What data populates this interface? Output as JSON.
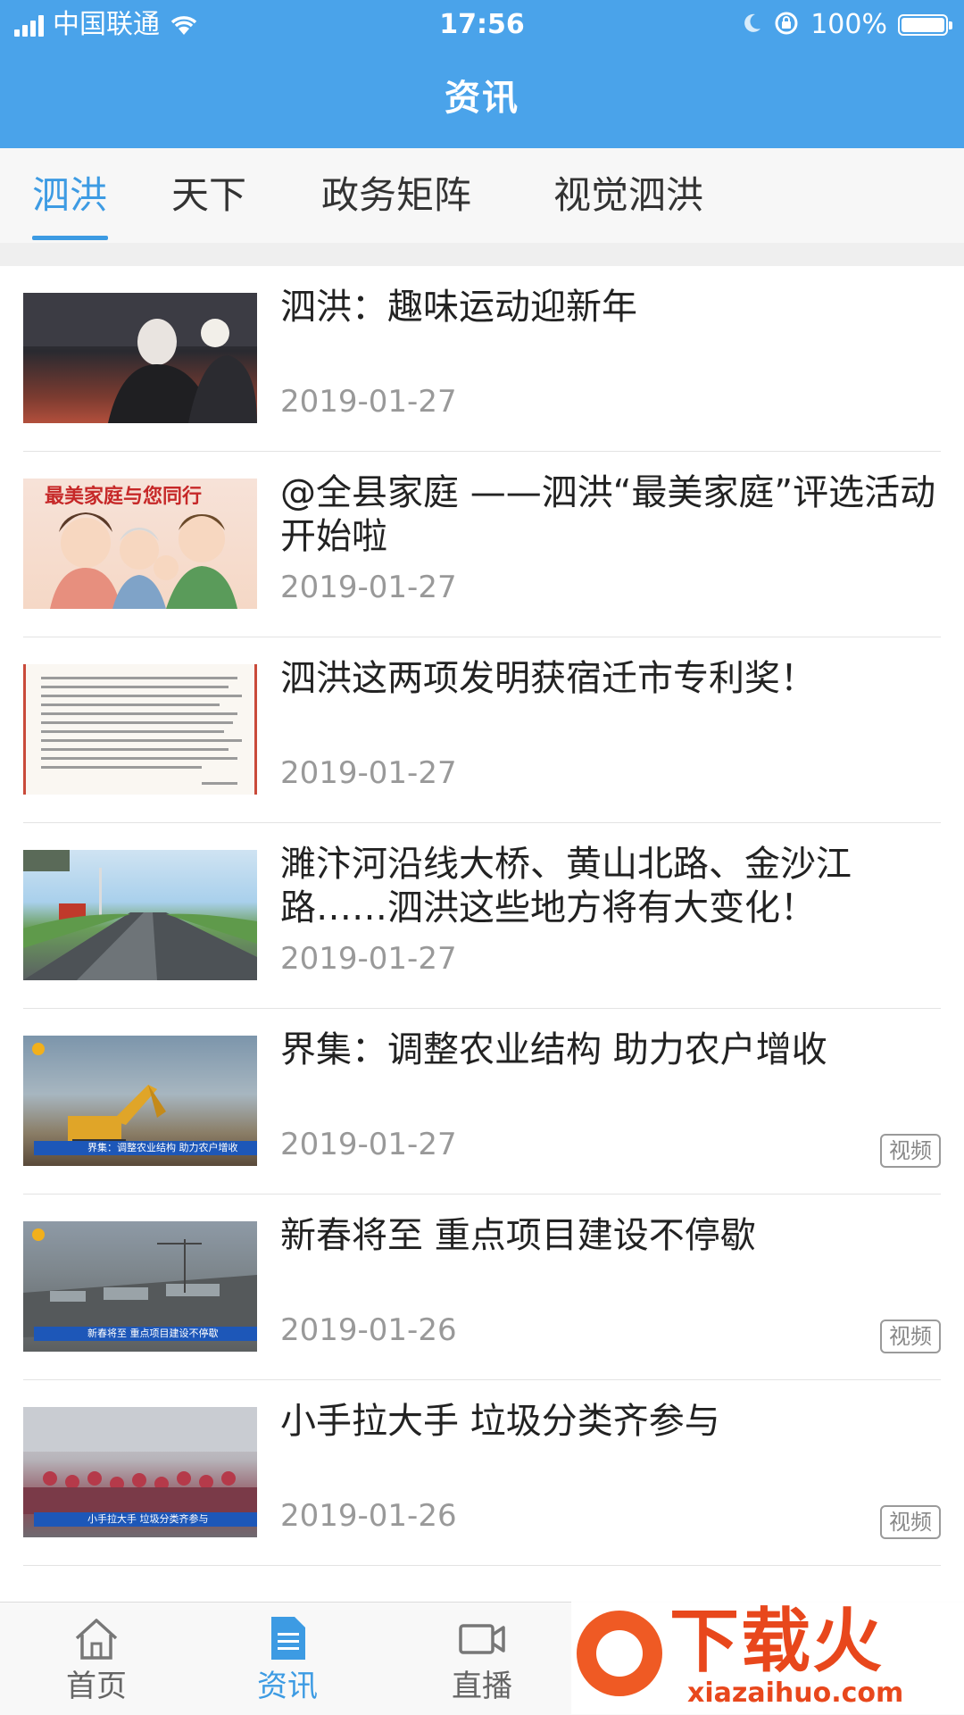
{
  "status_bar": {
    "carrier": "中国联通",
    "time": "17:56",
    "battery": "100%"
  },
  "header": {
    "title": "资讯"
  },
  "tabs": [
    {
      "label": "泗洪",
      "active": true
    },
    {
      "label": "天下",
      "active": false
    },
    {
      "label": "政务矩阵",
      "active": false
    },
    {
      "label": "视觉泗洪",
      "active": false
    }
  ],
  "news": [
    {
      "title": "泗洪：趣味运动迎新年",
      "date": "2019-01-27"
    },
    {
      "title": "@全县家庭 ——泗洪“最美家庭”评选活动开始啦",
      "date": "2019-01-27",
      "thumb_caption": "最美家庭与您同行"
    },
    {
      "title": "泗洪这两项发明获宿迁市专利奖！",
      "date": "2019-01-27"
    },
    {
      "title": "濉汴河沿线大桥、黄山北路、金沙江路……泗洪这些地方将有大变化！",
      "date": "2019-01-27"
    },
    {
      "title": "界集：调整农业结构 助力农户增收",
      "date": "2019-01-27",
      "badge": "视频",
      "thumb_caption": "界集：调整农业结构 助力农户增收"
    },
    {
      "title": "新春将至 重点项目建设不停歇",
      "date": "2019-01-26",
      "badge": "视频",
      "thumb_caption": "新春将至 重点项目建设不停歇"
    },
    {
      "title": "小手拉大手 垃圾分类齐参与",
      "date": "2019-01-26",
      "badge": "视频",
      "thumb_caption": "小手拉大手 垃圾分类齐参与"
    }
  ],
  "bottom_nav": [
    {
      "label": "首页",
      "icon": "home-icon",
      "active": false
    },
    {
      "label": "资讯",
      "icon": "document-icon",
      "active": true
    },
    {
      "label": "直播",
      "icon": "video-camera-icon",
      "active": false
    }
  ],
  "watermark": {
    "text": "下载火",
    "url": "xiazaihuo.com"
  },
  "colors": {
    "accent": "#3d9be3",
    "header_bg": "#4aa3ea"
  }
}
